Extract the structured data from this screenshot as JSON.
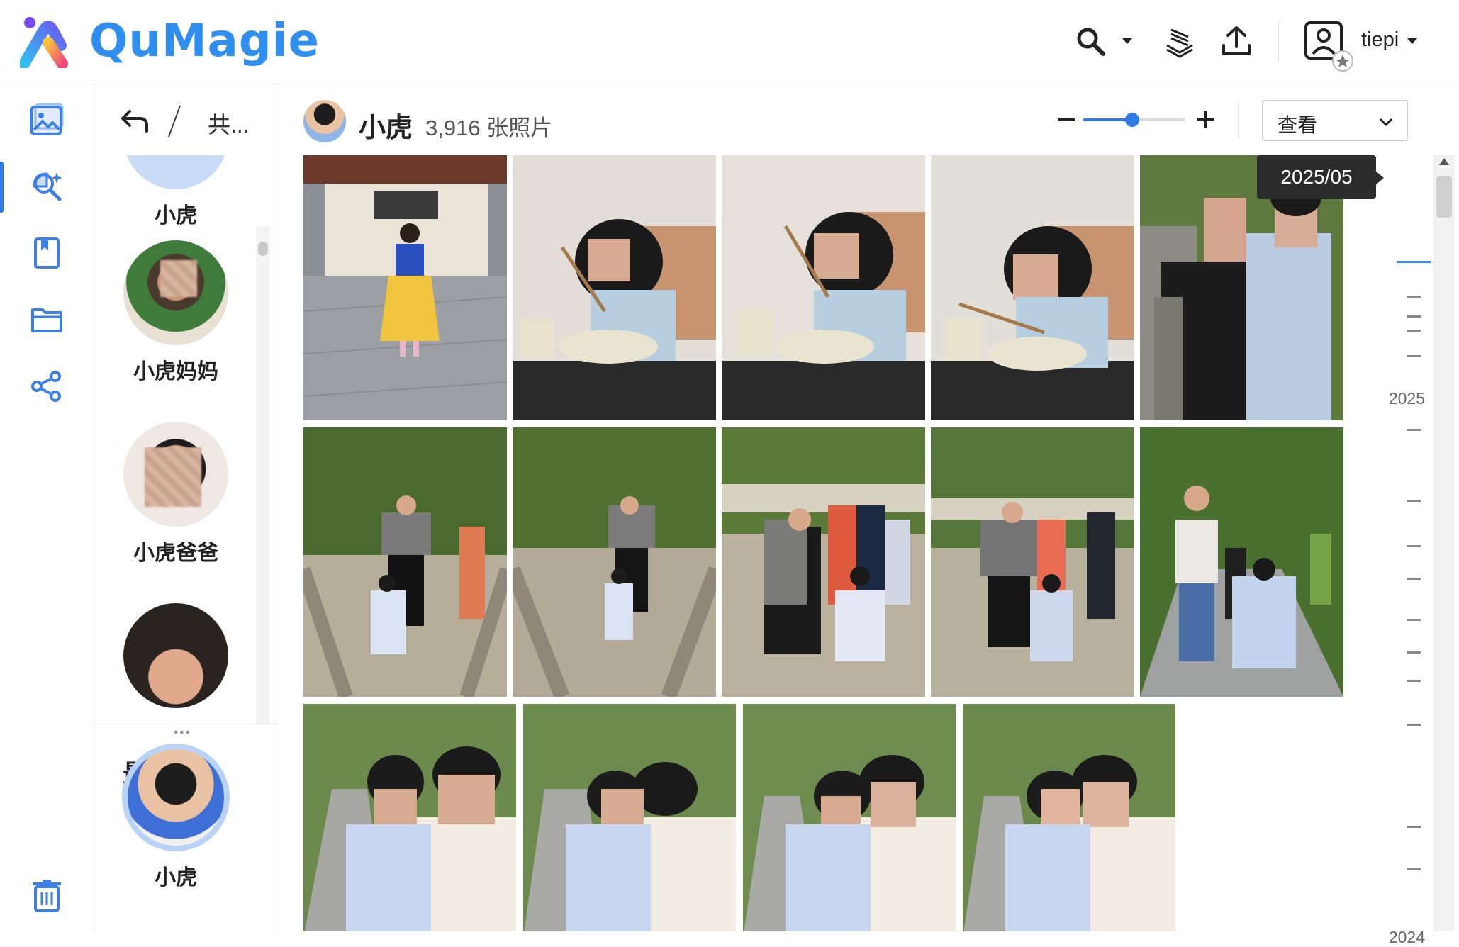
{
  "app": {
    "brand": "QuMagie",
    "user": "tiepi"
  },
  "toolbar": {
    "icons": [
      "search-icon",
      "chevron-down-icon",
      "background-tasks-icon",
      "upload-icon",
      "user-profile-icon",
      "chevron-down-icon"
    ]
  },
  "rail": {
    "items": [
      "photos-icon",
      "ai-recognition-icon",
      "album-icon",
      "folder-icon",
      "share-icon",
      "trash-icon"
    ],
    "active": "ai-recognition-icon"
  },
  "panel": {
    "breadcrumb": "共...",
    "people": [
      {
        "name": "小虎"
      },
      {
        "name": "小虎妈妈"
      },
      {
        "name": "小虎爸爸"
      }
    ],
    "recent_title": "最近",
    "recent": [
      {
        "name": "小虎"
      }
    ]
  },
  "main": {
    "title": "小虎",
    "count": "3,916 张照片",
    "view_label": "查看",
    "zoom_level": 0.48,
    "tooltip": "2025/05",
    "timeline": {
      "years": [
        "2025",
        "2024"
      ]
    }
  },
  "accent": "#2f7be8"
}
